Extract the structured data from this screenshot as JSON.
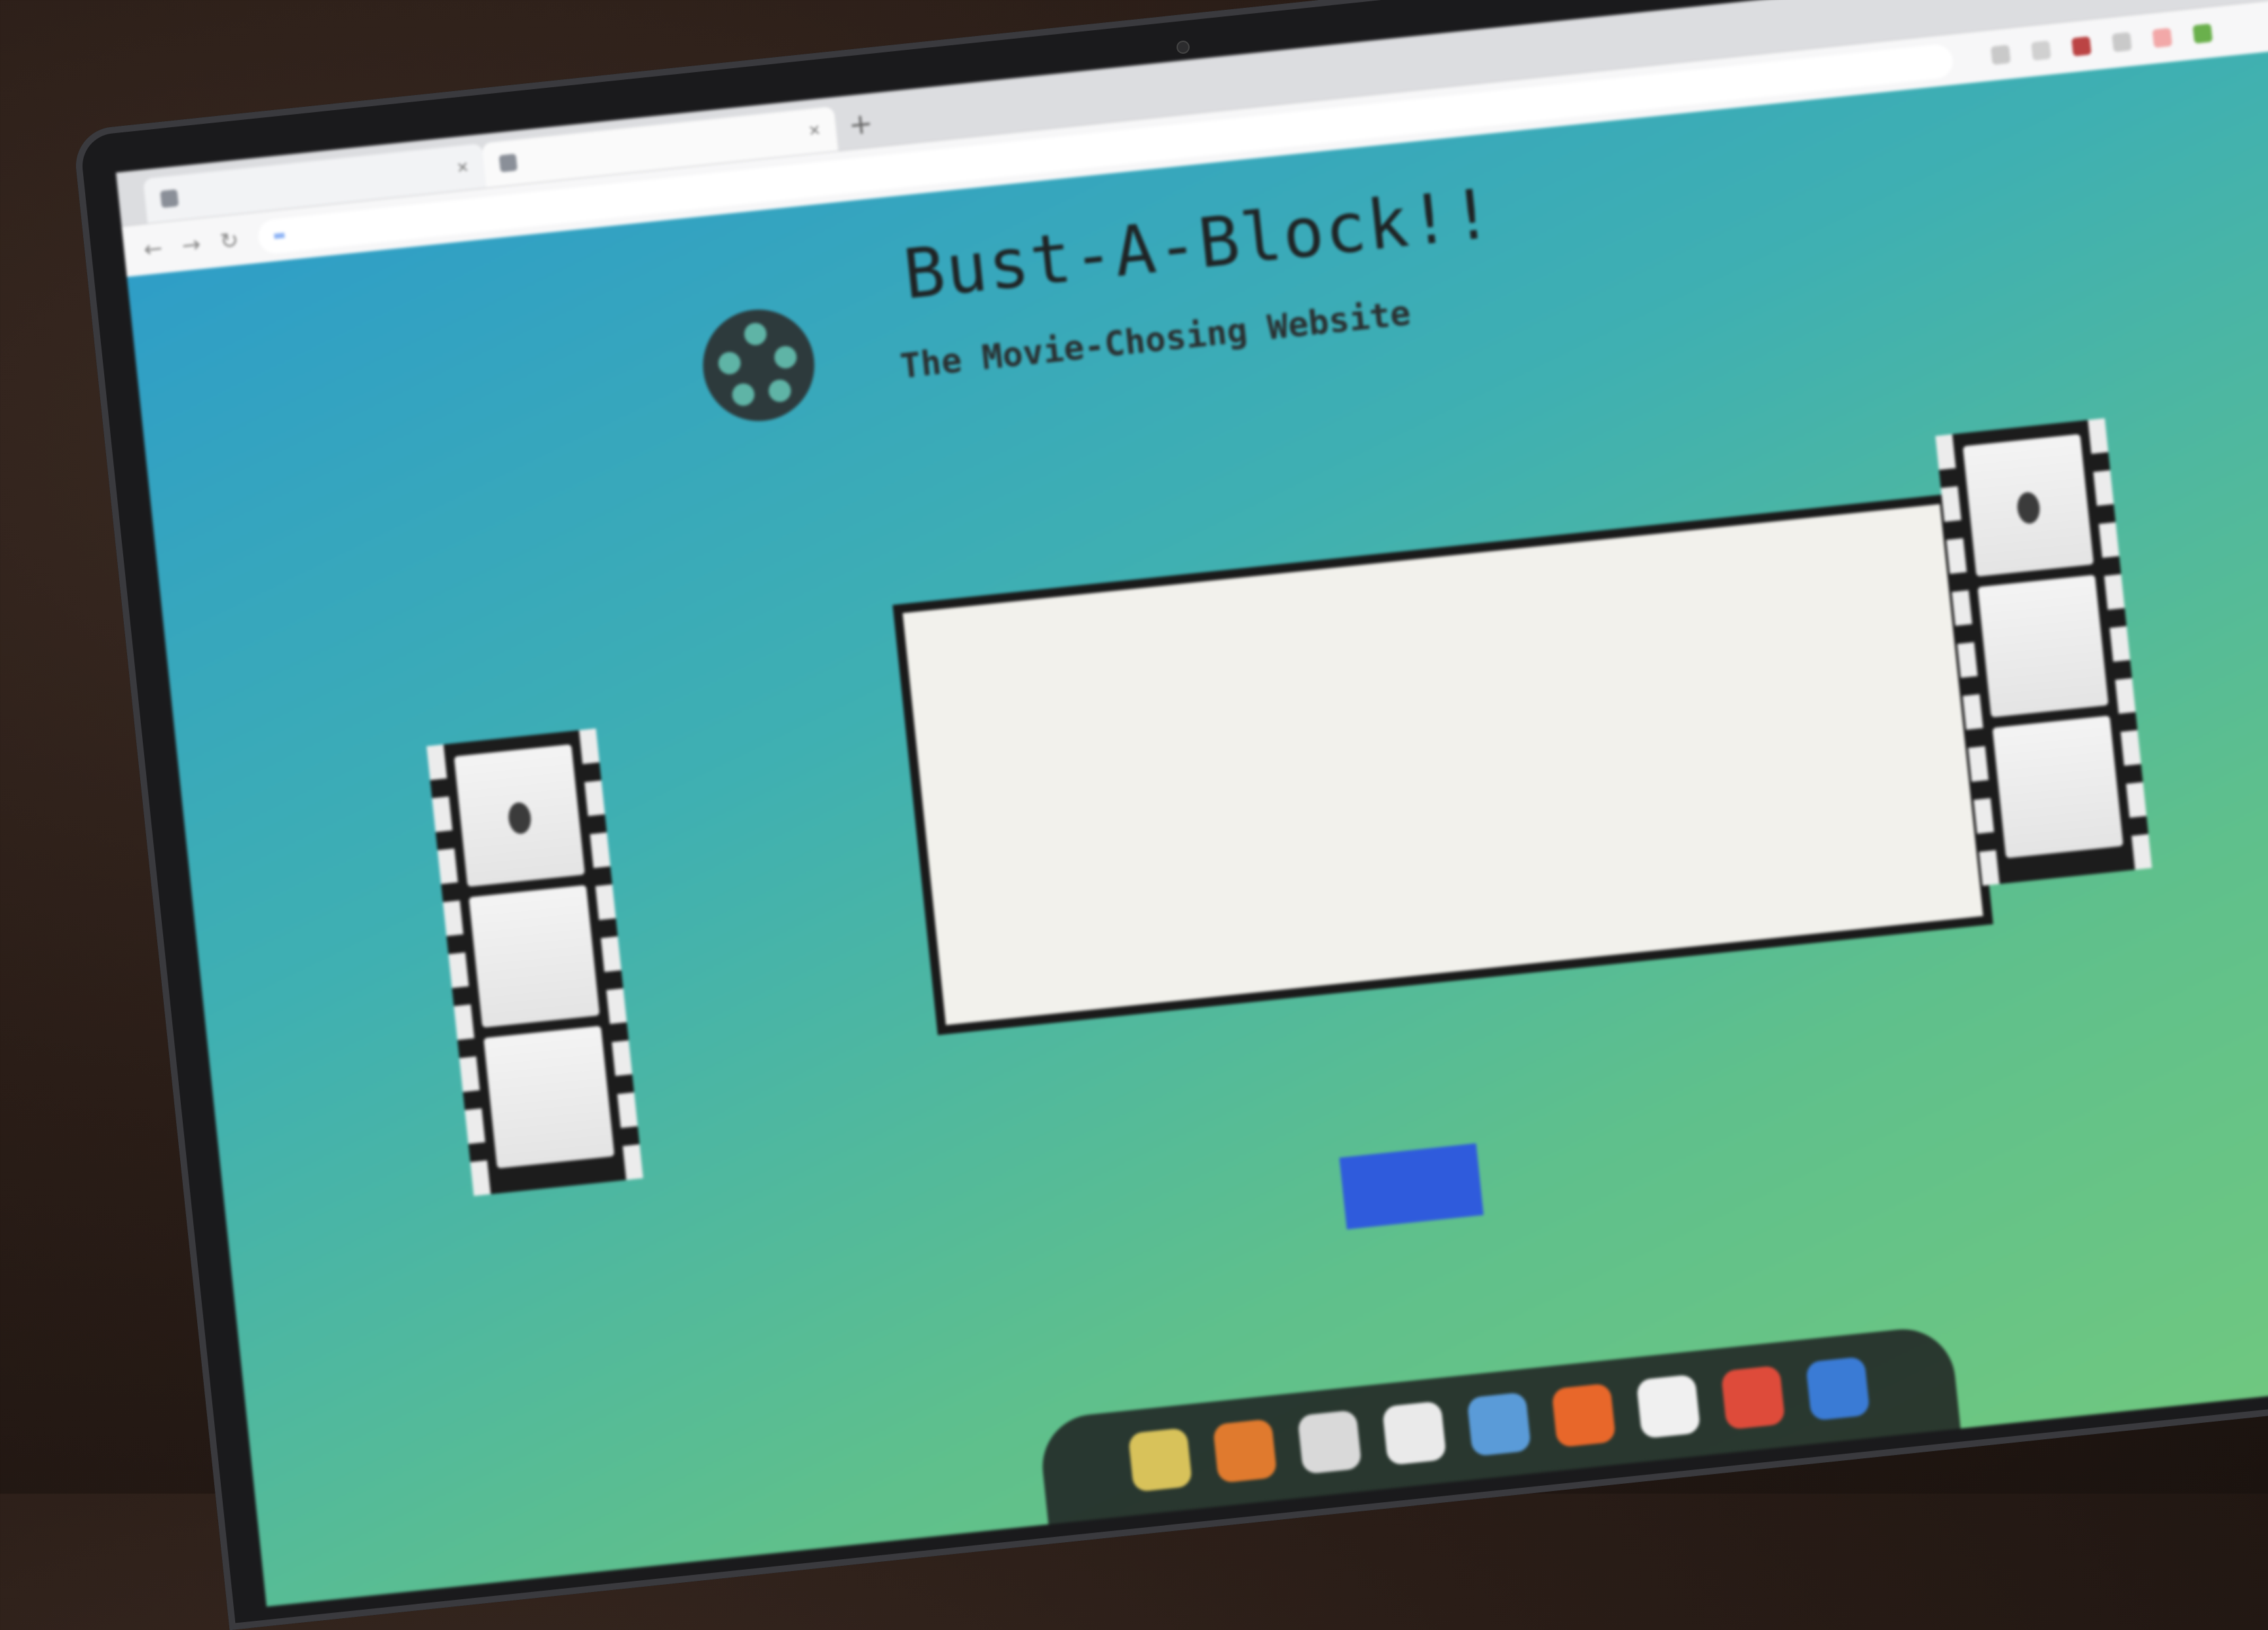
{
  "browser": {
    "tabs": [
      {
        "label": "",
        "active": false
      },
      {
        "label": "",
        "active": true
      }
    ],
    "url": ""
  },
  "site": {
    "title": "Bust-A-Block!!",
    "subtitle": "The Movie-Chosing Website",
    "intro": "",
    "start_button": ""
  },
  "colors": {
    "gradient_start": "#2f9ec7",
    "gradient_end": "#72c97e",
    "button": "#2f5bdc"
  },
  "icons": [
    "film-reel-logo-icon",
    "filmstrip-left-icon",
    "filmstrip-right-icon"
  ]
}
